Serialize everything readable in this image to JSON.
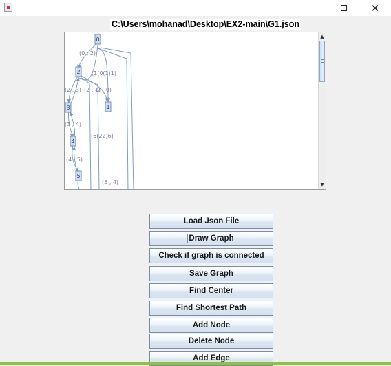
{
  "window": {
    "minimize_glyph": "",
    "maximize_glyph": "",
    "close_glyph": "✕"
  },
  "file_path": "C:\\Users\\mohanad\\Desktop\\EX2-main\\G1.json",
  "graph": {
    "nodes": [
      {
        "id": "0",
        "label": "0"
      },
      {
        "id": "1",
        "label": "1"
      },
      {
        "id": "2",
        "label": "2"
      },
      {
        "id": "3",
        "label": "3"
      },
      {
        "id": "4",
        "label": "4"
      },
      {
        "id": "5",
        "label": "5"
      }
    ],
    "edge_labels": [
      "(0 , 2)",
      "(1(0(1)1)",
      "(2 , 3)",
      "(2 , 1)",
      "(2 , 0)",
      "(3 , 4)",
      "(4 , 5)",
      "(6(2 2)6)",
      "(5 , 4)"
    ],
    "edge_label_text": [
      "(0 , 2)",
      "(1(0(1)1)",
      "(2 , 3)",
      "(2 , 1)",
      "(2 , 0)",
      "(3 , 4)",
      "(4 , 5)",
      "(6(22)6)",
      "(5 , 4)"
    ]
  },
  "buttons": [
    {
      "label": "Load Json File"
    },
    {
      "label": "Draw Graph"
    },
    {
      "label": "Check if graph is connected"
    },
    {
      "label": "Save Graph"
    },
    {
      "label": "Find Center"
    },
    {
      "label": "Find Shortest Path"
    },
    {
      "label": "Add Node"
    },
    {
      "label": "Delete Node"
    },
    {
      "label": "Add Edge"
    }
  ],
  "colors": {
    "edge": "#7f9cc8",
    "node_fill": "#cfdcef",
    "node_stroke": "#6e8fbf",
    "label": "#7a7a9a",
    "taskbar": "#8cc04a"
  }
}
